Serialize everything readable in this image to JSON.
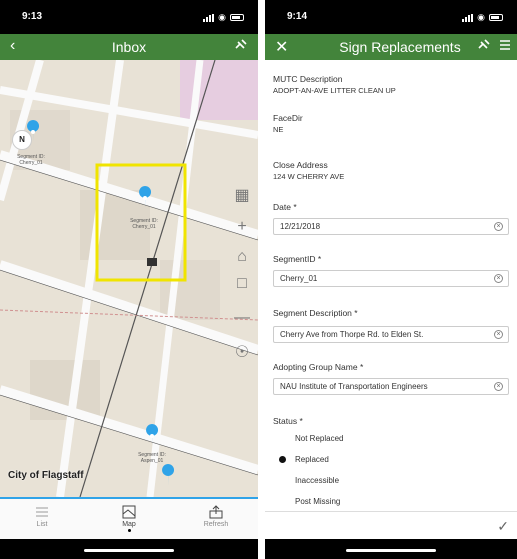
{
  "left": {
    "status": {
      "time": "9:13"
    },
    "nav": {
      "title": "Inbox"
    },
    "map": {
      "compass": "N",
      "attribution": "City of Flagstaff",
      "pins": [
        {
          "label": "Segment ID: Cherry_01"
        },
        {
          "label": "Segment ID: Cherry_01"
        },
        {
          "label": "Segment ID: Aspen_01"
        }
      ]
    },
    "tabs": [
      {
        "label": "List"
      },
      {
        "label": "Map"
      },
      {
        "label": "Refresh"
      }
    ]
  },
  "right": {
    "status": {
      "time": "9:14"
    },
    "nav": {
      "title": "Sign Replacements"
    },
    "fields": {
      "mutc_label": "MUTC Description",
      "mutc_value": "ADOPT-AN-AVE LITTER CLEAN UP",
      "facedir_label": "FaceDir",
      "facedir_value": "NE",
      "address_label": "Close Address",
      "address_value": "124 W CHERRY AVE",
      "date_label": "Date *",
      "date_value": "12/21/2018",
      "segment_label": "SegmentID *",
      "segment_value": "Cherry_01",
      "segdesc_label": "Segment Description *",
      "segdesc_value": "Cherry Ave from Thorpe Rd. to Elden St.",
      "group_label": "Adopting Group Name *",
      "group_value": "NAU Institute of Transportation Engineers",
      "status_label": "Status *"
    },
    "status_options": [
      {
        "label": "Not Replaced",
        "selected": false
      },
      {
        "label": "Replaced",
        "selected": true
      },
      {
        "label": "Inaccessible",
        "selected": false
      },
      {
        "label": "Post Missing",
        "selected": false
      }
    ]
  },
  "colors": {
    "nav_green": "#43843b",
    "pin_blue": "#2fa3e8",
    "highlight_yellow": "#f0e400"
  }
}
